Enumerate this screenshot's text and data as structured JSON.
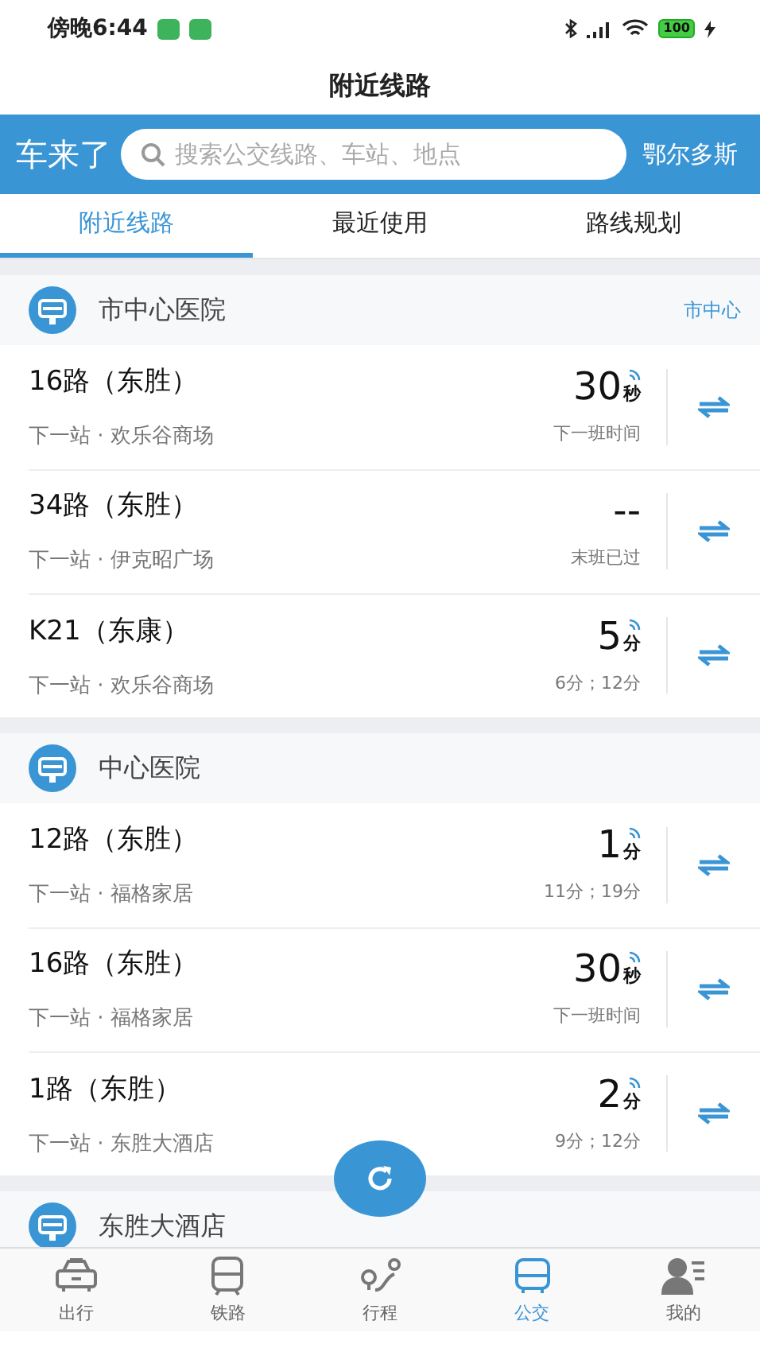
{
  "status_bar": {
    "time": "傍晚6:44",
    "battery": "100"
  },
  "window": {
    "title": "附近线路"
  },
  "header": {
    "brand": "车来了",
    "search": {
      "placeholder": "搜索公交线路、车站、地点"
    },
    "city": "鄂尔多斯"
  },
  "tabs": [
    {
      "label": "附近线路",
      "selected": true
    },
    {
      "label": "最近使用",
      "selected": false
    },
    {
      "label": "路线规划",
      "selected": false
    }
  ],
  "stations": [
    {
      "name": "市中心医院",
      "tag": "市中心",
      "routes": [
        {
          "route": "16路（东胜）",
          "next_stop": "下一站 · 欢乐谷商场",
          "time": "30",
          "unit": "秒",
          "realtime": true,
          "note": "下一班时间"
        },
        {
          "route": "34路（东胜）",
          "next_stop": "下一站 · 伊克昭广场",
          "time": "--",
          "realtime": false,
          "note": "末班已过"
        },
        {
          "route": "K21（东康）",
          "next_stop": "下一站 · 欢乐谷商场",
          "time": "5",
          "unit": "分",
          "realtime": true,
          "note": "6分；12分"
        }
      ]
    },
    {
      "name": "中心医院",
      "routes": [
        {
          "route": "12路（东胜）",
          "next_stop": "下一站 · 福格家居",
          "time": "1",
          "unit": "分",
          "realtime": true,
          "note": "11分；19分"
        },
        {
          "route": "16路（东胜）",
          "next_stop": "下一站 · 福格家居",
          "time": "30",
          "unit": "秒",
          "realtime": true,
          "note": "下一班时间"
        },
        {
          "route": "1路（东胜）",
          "next_stop": "下一站 · 东胜大酒店",
          "time": "2",
          "unit": "分",
          "realtime": true,
          "note": "9分；12分"
        }
      ]
    },
    {
      "name": "东胜大酒店"
    }
  ],
  "nav": [
    {
      "kind": "taxi",
      "label": "出行",
      "selected": false
    },
    {
      "kind": "train",
      "label": "铁路",
      "selected": false
    },
    {
      "kind": "route",
      "label": "行程",
      "selected": false
    },
    {
      "kind": "bus",
      "label": "公交",
      "selected": true
    },
    {
      "kind": "profile",
      "label": "我的",
      "selected": false
    }
  ]
}
